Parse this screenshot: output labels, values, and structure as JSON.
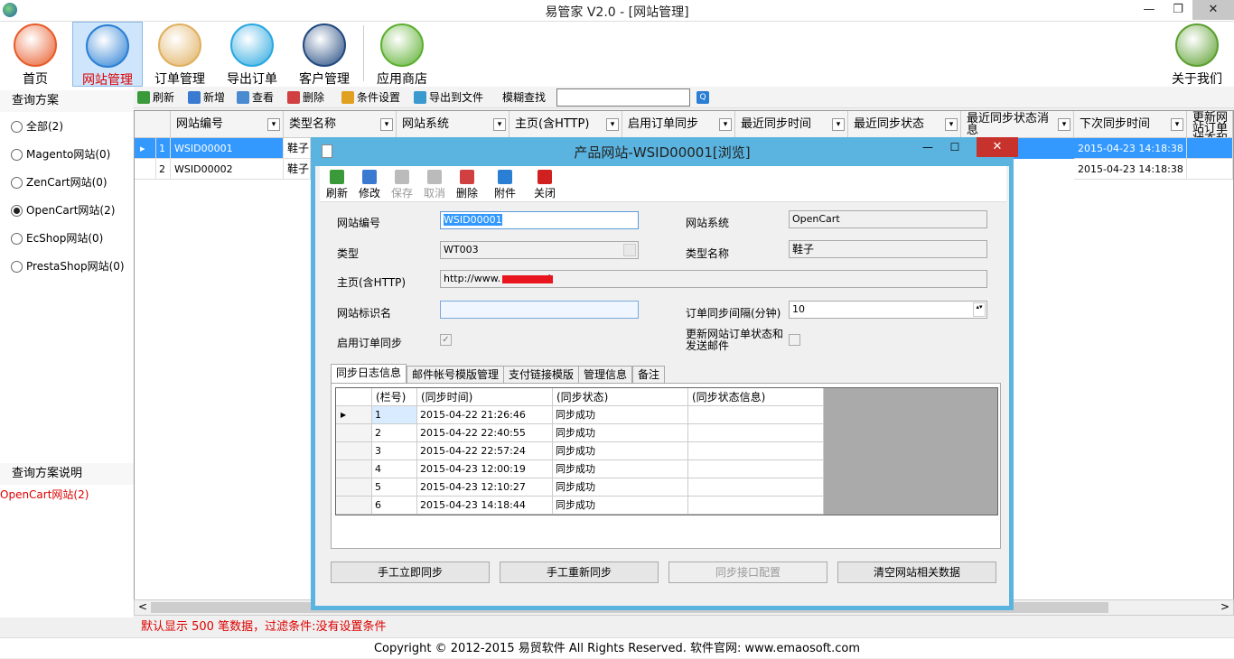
{
  "window": {
    "title": "易管家 V2.0 - [网站管理]",
    "min": "—",
    "max": "❐",
    "close": "✕"
  },
  "ribbon": [
    {
      "label": "首页",
      "icon": "home-chart-icon",
      "color": "#e85c2a"
    },
    {
      "label": "网站管理",
      "icon": "website-manage-icon",
      "color": "#2a7fd4",
      "active": true
    },
    {
      "label": "订单管理",
      "icon": "order-icon",
      "color": "#e0b060"
    },
    {
      "label": "导出订单",
      "icon": "cloud-export-icon",
      "color": "#2aa8e0"
    },
    {
      "label": "客户管理",
      "icon": "customer-icon",
      "color": "#234a80"
    },
    {
      "label": "应用商店",
      "icon": "shopping-cart-icon",
      "color": "#5cb030"
    },
    {
      "label": "关于我们",
      "icon": "about-book-icon",
      "color": "#5ca030"
    }
  ],
  "toolbar": {
    "items": [
      {
        "label": "刷新",
        "icon": "refresh-icon",
        "color": "#3a9a3a"
      },
      {
        "label": "新增",
        "icon": "add-icon",
        "color": "#3a7ad0"
      },
      {
        "label": "查看",
        "icon": "view-icon",
        "color": "#4a8ad0"
      },
      {
        "label": "删除",
        "icon": "delete-icon",
        "color": "#d04040"
      },
      {
        "label": "条件设置",
        "icon": "filter-settings-icon",
        "color": "#e0a020"
      },
      {
        "label": "导出到文件",
        "icon": "export-file-icon",
        "color": "#3a9ad0"
      }
    ],
    "fuzzy_label": "模糊查找",
    "fuzzy_value": "",
    "search_btn": "Q"
  },
  "left": {
    "header": "查询方案",
    "options": [
      {
        "label": "全部(2)",
        "on": false
      },
      {
        "label": "Magento网站(0)",
        "on": false
      },
      {
        "label": "ZenCart网站(0)",
        "on": false
      },
      {
        "label": "OpenCart网站(2)",
        "on": true
      },
      {
        "label": "EcShop网站(0)",
        "on": false
      },
      {
        "label": "PrestaShop网站(0)",
        "on": false
      }
    ],
    "desc_header": "查询方案说明",
    "desc_value": "OpenCart网站(2)"
  },
  "grid": {
    "columns": [
      "网站编号",
      "类型名称",
      "网站系统",
      "主页(含HTTP)",
      "启用订单同步",
      "最近同步时间",
      "最近同步状态",
      "最近同步状态消息",
      "下次同步时间",
      "更新网站订单状态和发送"
    ],
    "rows": [
      {
        "no": "1",
        "code": "WSID00001",
        "type": "鞋子",
        "next": "2015-04-23 14:18:38",
        "selected": true,
        "arrow": "▸"
      },
      {
        "no": "2",
        "code": "WSID00002",
        "type": "鞋子",
        "next": "2015-04-23 14:18:38",
        "selected": false,
        "arrow": ""
      }
    ],
    "scroll_left": "<",
    "scroll_right": ">"
  },
  "status": "默认显示 500 笔数据，过滤条件:没有设置条件",
  "footer": "Copyright © 2012-2015 易贸软件 All Rights Reserved. 软件官网: www.emaosoft.com",
  "dialog": {
    "title": "产品网站-WSID00001[浏览]",
    "min": "—",
    "max": "☐",
    "close": "✕",
    "toolbar": [
      {
        "label": "刷新",
        "icon": "refresh-icon",
        "color": "#3a9a3a",
        "dis": false
      },
      {
        "label": "修改",
        "icon": "edit-icon",
        "color": "#3a7ad0",
        "dis": false
      },
      {
        "label": "保存",
        "icon": "save-icon",
        "color": "#bbb",
        "dis": true
      },
      {
        "label": "取消",
        "icon": "cancel-icon",
        "color": "#bbb",
        "dis": true
      },
      {
        "label": "删除",
        "icon": "delete-icon",
        "color": "#d04040",
        "dis": false
      },
      {
        "label": "附件",
        "icon": "attachment-icon",
        "color": "#2a7fd4",
        "dis": false
      },
      {
        "label": "关闭",
        "icon": "close-circle-icon",
        "color": "#d02020",
        "dis": false
      }
    ],
    "fields": {
      "code_label": "网站编号",
      "code": "WSID00001",
      "system_label": "网站系统",
      "system": "OpenCart",
      "type_label": "类型",
      "type": "WT003",
      "typename_label": "类型名称",
      "typename": "鞋子",
      "home_label": "主页(含HTTP)",
      "home": "http://www.            .nl",
      "ident_label": "网站标识名",
      "ident": "",
      "interval_label": "订单同步间隔(分钟)",
      "interval": "10",
      "sync_label": "启用订单同步",
      "sync_check": "✓",
      "update_label": "更新网站订单状态和发送邮件",
      "spin": "▴▾"
    },
    "tabs": [
      "同步日志信息",
      "邮件帐号模版管理",
      "支付链接模版",
      "管理信息",
      "备注"
    ],
    "log_columns": [
      "(栏号)",
      "(同步时间)",
      "(同步状态)",
      "(同步状态信息)"
    ],
    "log_rows": [
      {
        "no": "1",
        "time": "2015-04-22 21:26:46",
        "state": "同步成功",
        "info": "",
        "arrow": "▶"
      },
      {
        "no": "2",
        "time": "2015-04-22 22:40:55",
        "state": "同步成功",
        "info": "",
        "arrow": ""
      },
      {
        "no": "3",
        "time": "2015-04-22 22:57:24",
        "state": "同步成功",
        "info": "",
        "arrow": ""
      },
      {
        "no": "4",
        "time": "2015-04-23 12:00:19",
        "state": "同步成功",
        "info": "",
        "arrow": ""
      },
      {
        "no": "5",
        "time": "2015-04-23 12:10:27",
        "state": "同步成功",
        "info": "",
        "arrow": ""
      },
      {
        "no": "6",
        "time": "2015-04-23 14:18:44",
        "state": "同步成功",
        "info": "",
        "arrow": ""
      }
    ],
    "buttons": [
      {
        "label": "手工立即同步",
        "dis": false
      },
      {
        "label": "手工重新同步",
        "dis": false
      },
      {
        "label": "同步接口配置",
        "dis": true
      },
      {
        "label": "清空网站相关数据",
        "dis": false
      }
    ]
  }
}
